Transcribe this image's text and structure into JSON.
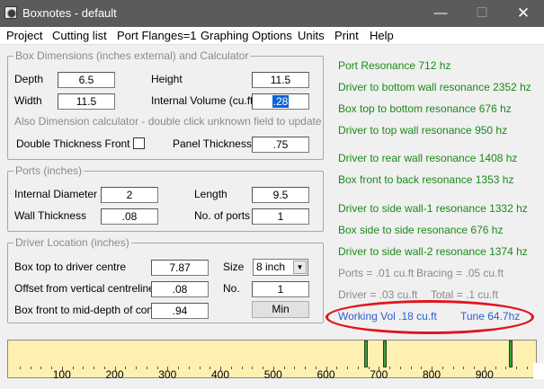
{
  "window": {
    "title": "Boxnotes - default",
    "minimize": "—",
    "maximize": "☐",
    "close": "✕"
  },
  "menu": [
    "Project",
    "Cutting list",
    "Port Flanges=1",
    "Graphing Options",
    "Units",
    "Print",
    "Help"
  ],
  "box": {
    "title": "Box Dimensions (inches external) and Calculator",
    "depth_label": "Depth",
    "depth_value": "6.5",
    "height_label": "Height",
    "height_value": "11.5",
    "width_label": "Width",
    "width_value": "11.5",
    "volume_label": "Internal Volume (cu.ft)",
    "volume_value": ".28",
    "calc_hint": "Also Dimension calculator - double click unknown field to update",
    "double_thickness_label": "Double Thickness Front",
    "double_thickness_checked": false,
    "panel_thickness_label": "Panel Thickness",
    "panel_thickness_value": ".75"
  },
  "ports": {
    "title": "Ports (inches)",
    "diameter_label": "Internal Diameter",
    "diameter_value": "2",
    "length_label": "Length",
    "length_value": "9.5",
    "wall_label": "Wall Thickness",
    "wall_value": ".08",
    "count_label": "No. of ports",
    "count_value": "1"
  },
  "driver": {
    "title": "Driver Location (inches)",
    "top_label": "Box top to driver centre",
    "top_value": "7.87",
    "size_label": "Size",
    "size_value": "8 inch",
    "offset_label": "Offset from vertical centreline",
    "offset_value": ".08",
    "no_label": "No.",
    "no_value": "1",
    "front_label": "Box front to mid-depth of cone",
    "front_value": ".94",
    "min_button": "Min"
  },
  "resonances": {
    "port": "Port Resonance  712 hz",
    "driver_bottom": "Driver to bottom wall resonance  2352 hz",
    "top_bottom": "Box top to bottom resonance  676 hz",
    "driver_top": "Driver to top wall resonance  950 hz",
    "driver_rear": "Driver to rear wall resonance 1408 hz",
    "front_back": "Box front to back resonance  1353 hz",
    "driver_side1": "Driver to side wall-1 resonance  1332 hz",
    "side_side": "Box side to side resonance  676 hz",
    "driver_side2": "Driver to side wall-2 resonance  1374 hz"
  },
  "volumes": {
    "ports": "Ports = .01 cu.ft",
    "bracing": "Bracing = .05 cu.ft",
    "driver": "Driver =  .03 cu.ft",
    "total": "Total =  .1 cu.ft",
    "working": "Working Vol  .18 cu.ft",
    "tune": "Tune  64.7hz"
  },
  "colors": {
    "resonance": "#1a8a1a",
    "highlight": "#e0141e",
    "working": "#2a5fd0",
    "graph_bg": "#fdf0b0",
    "spike": "#2ea82e"
  },
  "graph": {
    "axis_labels": [
      "100",
      "200",
      "300",
      "400",
      "500",
      "600",
      "700",
      "800",
      "900"
    ],
    "axis_range": [
      0,
      1000
    ],
    "spikes_hz": [
      676,
      712,
      950
    ]
  }
}
